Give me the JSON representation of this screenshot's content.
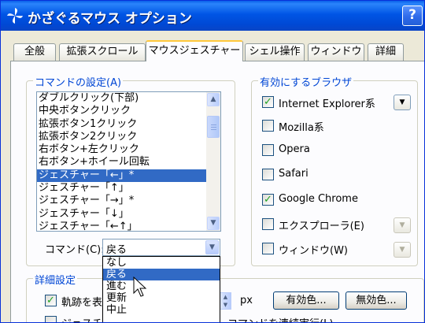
{
  "window": {
    "title": "かざぐるマウス オプション",
    "help_label": "?"
  },
  "tabs": [
    {
      "label": "全般"
    },
    {
      "label": "拡張スクロール"
    },
    {
      "label": "マウスジェスチャー",
      "active": true
    },
    {
      "label": "シェル操作"
    },
    {
      "label": "ウィンドウ"
    },
    {
      "label": "詳細"
    }
  ],
  "command_group": {
    "title": "コマンドの設定(A)",
    "items": [
      "ダブルクリック(下部)",
      "中央ボタンクリック",
      "拡張ボタン1クリック",
      "拡張ボタン2クリック",
      "右ボタン+左クリック",
      "右ボタン+ホイール回転",
      "ジェスチャー「←」*",
      "ジェスチャー「↑」",
      "ジェスチャー「→」*",
      "ジェスチャー「↓」",
      "ジェスチャー「←↑」"
    ],
    "selected_index": 6,
    "command_label": "コマンド(C):",
    "command_value": "戻る",
    "dropdown_options": [
      "なし",
      "戻る",
      "進む",
      "更新",
      "中止"
    ],
    "dropdown_highlight": 1
  },
  "browser_group": {
    "title": "有効にするブラウザ",
    "items": [
      {
        "label": "Internet Explorer系",
        "checked": true
      },
      {
        "label": "Mozilla系",
        "checked": false
      },
      {
        "label": "Opera",
        "checked": false
      },
      {
        "label": "Safari",
        "checked": false
      },
      {
        "label": "Google Chrome",
        "checked": true
      },
      {
        "label": "エクスプローラ(E)",
        "checked": false
      },
      {
        "label": "ウィンドウ(W)",
        "checked": false
      }
    ]
  },
  "details_group": {
    "title": "詳細設定",
    "trail_label": "軌跡を表示",
    "trail_checked": true,
    "unit": "px",
    "enabled_color_button": "有効色...",
    "disabled_color_button": "無効色...",
    "continuous_label_start": "ジェスチャ",
    "continuous_label_end": "コマンドを連続実行(L)"
  },
  "colors": {
    "selection": "#316ac5",
    "group_title": "#0046d5",
    "tab_highlight": "#ffc83c"
  }
}
